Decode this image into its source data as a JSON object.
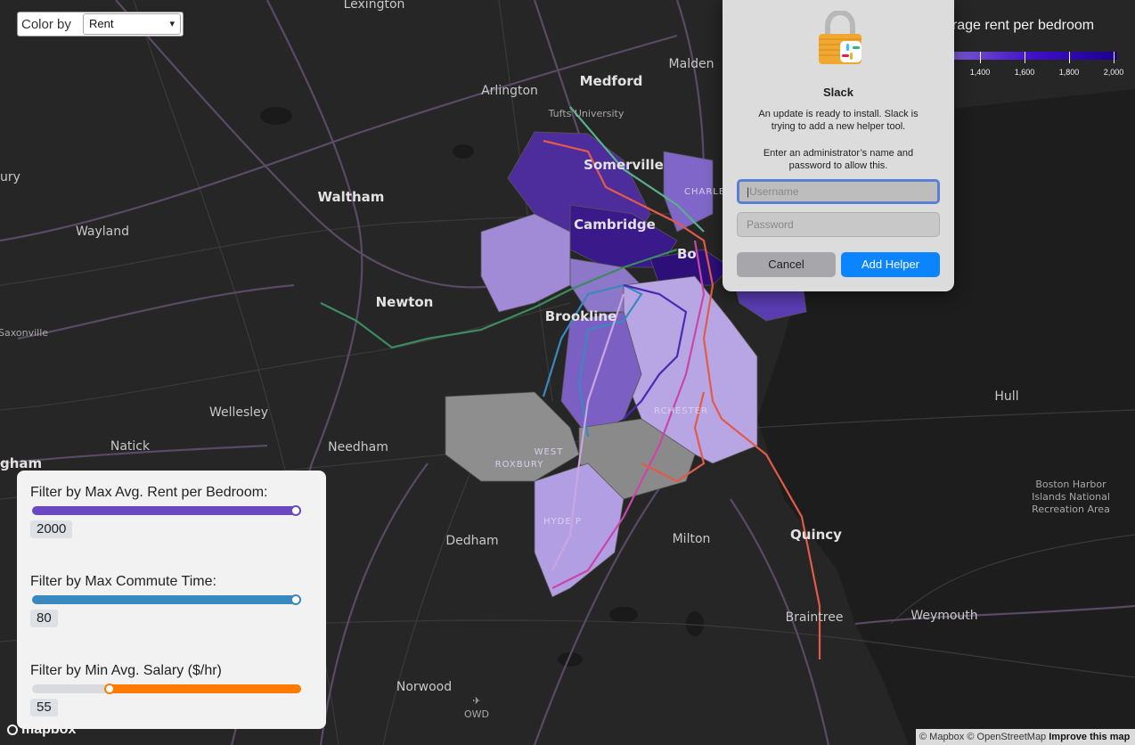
{
  "color_by": {
    "label": "Color by",
    "selected": "Rent"
  },
  "legend": {
    "title": "erage rent per bedroom",
    "ticks": [
      "1,400",
      "1,600",
      "1,800",
      "2,000"
    ],
    "colors": {
      "low": "#7a5bd0",
      "mid": "#3d10c8",
      "high": "#1c0090"
    }
  },
  "filters": {
    "rent": {
      "label": "Filter by Max Avg. Rent per Bedroom:",
      "value": "2000",
      "fraction": 1.0,
      "color": "#6a48c0"
    },
    "commute": {
      "label": "Filter by Max Commute Time:",
      "value": "80",
      "fraction": 1.0,
      "color": "#3a88c0"
    },
    "salary": {
      "label": "Filter by Min Avg. Salary ($/hr)",
      "value": "55",
      "fraction": 0.28,
      "color": "#ff7a00"
    }
  },
  "map_labels": {
    "lexington": "Lexington",
    "malden": "Malden",
    "arlington": "Arlington",
    "medford": "Medford",
    "tufts": "Tufts University",
    "somerville": "Somerville",
    "charlestown": "CHARLESTO",
    "waltham": "Waltham",
    "cambridge": "Cambridge",
    "wayland": "Wayland",
    "newton": "Newton",
    "brookline": "Brookline",
    "saxonville": "Saxonville",
    "wellesley": "Wellesley",
    "natick": "Natick",
    "needham": "Needham",
    "hull": "Hull",
    "dorchester": "RCHESTER",
    "west_roxbury_1": "WEST",
    "west_roxbury_2": "ROXBURY",
    "hyde_park": "HYDE P",
    "dedham": "Dedham",
    "milton": "Milton",
    "quincy": "Quincy",
    "braintree": "Braintree",
    "weymouth": "Weymouth",
    "norwood": "Norwood",
    "owd": "OWD",
    "harbor_1": "Boston Harbor",
    "harbor_2": "Islands National",
    "harbor_3": "Recreation Area",
    "edge_ury": "ury",
    "edge_gham": "gham",
    "boston": "Bo"
  },
  "dialog": {
    "app_name": "Slack",
    "message_1a": "An update is ready to install. Slack is",
    "message_1b": "trying to add a new helper tool.",
    "message_2a": "Enter an administrator’s name and",
    "message_2b": "password to allow this.",
    "username_placeholder": "Username",
    "password_placeholder": "Password",
    "cancel_label": "Cancel",
    "confirm_label": "Add Helper",
    "accent": "#0a84ff"
  },
  "attribution": {
    "mapbox": "© Mapbox",
    "osm": "© OpenStreetMap",
    "improve": "Improve this map",
    "logo": "mapbox"
  }
}
